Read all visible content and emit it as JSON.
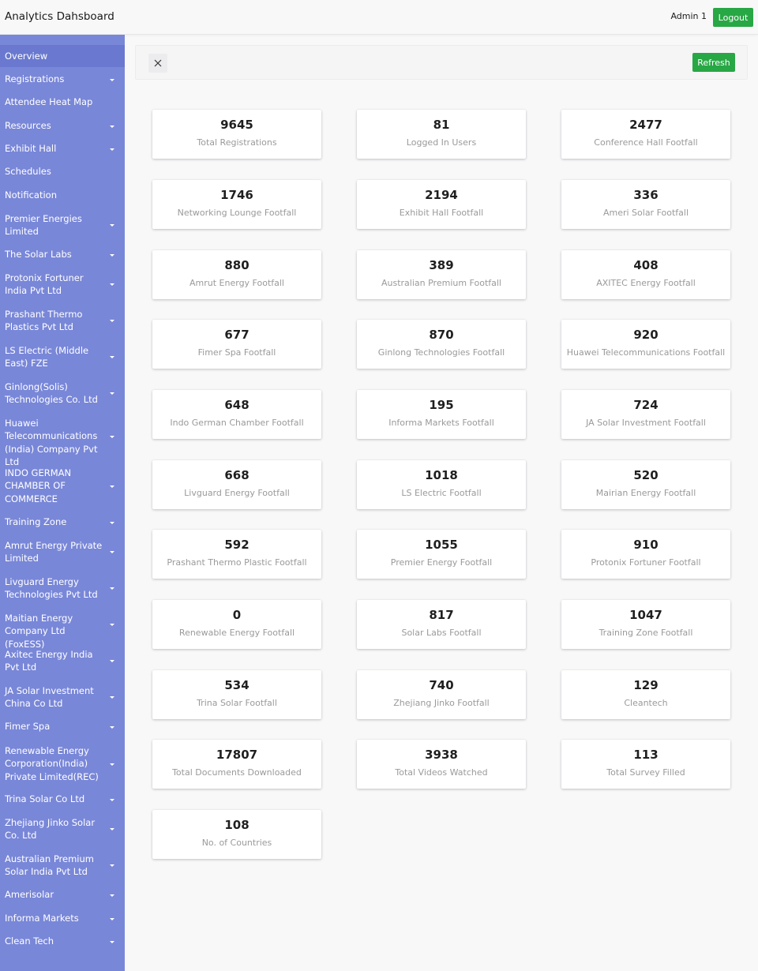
{
  "header": {
    "app_title": "Analytics Dahsboard",
    "user_name": "Admin 1",
    "logout_label": "Logout"
  },
  "toolbar": {
    "refresh_label": "Refresh"
  },
  "sidebar": {
    "items": [
      {
        "label": "Overview",
        "dropdown": false,
        "active": true
      },
      {
        "label": "Registrations",
        "dropdown": true
      },
      {
        "label": "Attendee Heat Map",
        "dropdown": false
      },
      {
        "label": "Resources",
        "dropdown": true
      },
      {
        "label": "Exhibit Hall",
        "dropdown": true
      },
      {
        "label": "Schedules",
        "dropdown": false
      },
      {
        "label": "Notification",
        "dropdown": false
      },
      {
        "label": "Premier Energies Limited",
        "dropdown": true
      },
      {
        "label": "The Solar Labs",
        "dropdown": true
      },
      {
        "label": "Protonix Fortuner India Pvt Ltd",
        "dropdown": true
      },
      {
        "label": "Prashant Thermo Plastics Pvt Ltd",
        "dropdown": true
      },
      {
        "label": "LS Electric (Middle East) FZE",
        "dropdown": true
      },
      {
        "label": "Ginlong(Solis) Technologies Co. Ltd",
        "dropdown": true
      },
      {
        "label": "Huawei Telecommunications (India) Company Pvt Ltd",
        "dropdown": true
      },
      {
        "label": "INDO GERMAN CHAMBER OF COMMERCE",
        "dropdown": true
      },
      {
        "label": "Training Zone",
        "dropdown": true
      },
      {
        "label": "Amrut Energy Private Limited",
        "dropdown": true
      },
      {
        "label": "Livguard Energy Technologies Pvt Ltd",
        "dropdown": true
      },
      {
        "label": "Maitian Energy Company Ltd (FoxESS)",
        "dropdown": true
      },
      {
        "label": "Axitec Energy India Pvt Ltd",
        "dropdown": true
      },
      {
        "label": "JA Solar Investment China Co Ltd",
        "dropdown": true
      },
      {
        "label": "Fimer Spa",
        "dropdown": true
      },
      {
        "label": "Renewable Energy Corporation(India) Private Limited(REC)",
        "dropdown": true
      },
      {
        "label": "Trina Solar Co Ltd",
        "dropdown": true
      },
      {
        "label": "Zhejiang Jinko Solar Co. Ltd",
        "dropdown": true
      },
      {
        "label": "Australian Premium Solar India Pvt Ltd",
        "dropdown": true
      },
      {
        "label": "Amerisolar",
        "dropdown": true
      },
      {
        "label": "Informa Markets",
        "dropdown": true
      },
      {
        "label": "Clean Tech",
        "dropdown": true
      }
    ]
  },
  "stats": [
    {
      "value": "9645",
      "label": "Total Registrations"
    },
    {
      "value": "81",
      "label": "Logged In Users"
    },
    {
      "value": "2477",
      "label": "Conference Hall Footfall"
    },
    {
      "value": "1746",
      "label": "Networking Lounge Footfall"
    },
    {
      "value": "2194",
      "label": "Exhibit Hall Footfall"
    },
    {
      "value": "336",
      "label": "Ameri Solar Footfall"
    },
    {
      "value": "880",
      "label": "Amrut Energy Footfall"
    },
    {
      "value": "389",
      "label": "Australian Premium Footfall"
    },
    {
      "value": "408",
      "label": "AXITEC Energy Footfall"
    },
    {
      "value": "677",
      "label": "Fimer Spa Footfall"
    },
    {
      "value": "870",
      "label": "Ginlong Technologies Footfall"
    },
    {
      "value": "920",
      "label": "Huawei Telecommunications Footfall"
    },
    {
      "value": "648",
      "label": "Indo German Chamber Footfall"
    },
    {
      "value": "195",
      "label": "Informa Markets Footfall"
    },
    {
      "value": "724",
      "label": "JA Solar Investment Footfall"
    },
    {
      "value": "668",
      "label": "Livguard Energy Footfall"
    },
    {
      "value": "1018",
      "label": "LS Electric Footfall"
    },
    {
      "value": "520",
      "label": "Mairian Energy Footfall"
    },
    {
      "value": "592",
      "label": "Prashant Thermo Plastic Footfall"
    },
    {
      "value": "1055",
      "label": "Premier Energy Footfall"
    },
    {
      "value": "910",
      "label": "Protonix Fortuner Footfall"
    },
    {
      "value": "0",
      "label": "Renewable Energy Footfall"
    },
    {
      "value": "817",
      "label": "Solar Labs Footfall"
    },
    {
      "value": "1047",
      "label": "Training Zone Footfall"
    },
    {
      "value": "534",
      "label": "Trina Solar Footfall"
    },
    {
      "value": "740",
      "label": "Zhejiang Jinko Footfall"
    },
    {
      "value": "129",
      "label": "Cleantech"
    },
    {
      "value": "17807",
      "label": "Total Documents Downloaded"
    },
    {
      "value": "3938",
      "label": "Total Videos Watched"
    },
    {
      "value": "113",
      "label": "Total Survey Filled"
    },
    {
      "value": "108",
      "label": "No. of Countries"
    }
  ]
}
